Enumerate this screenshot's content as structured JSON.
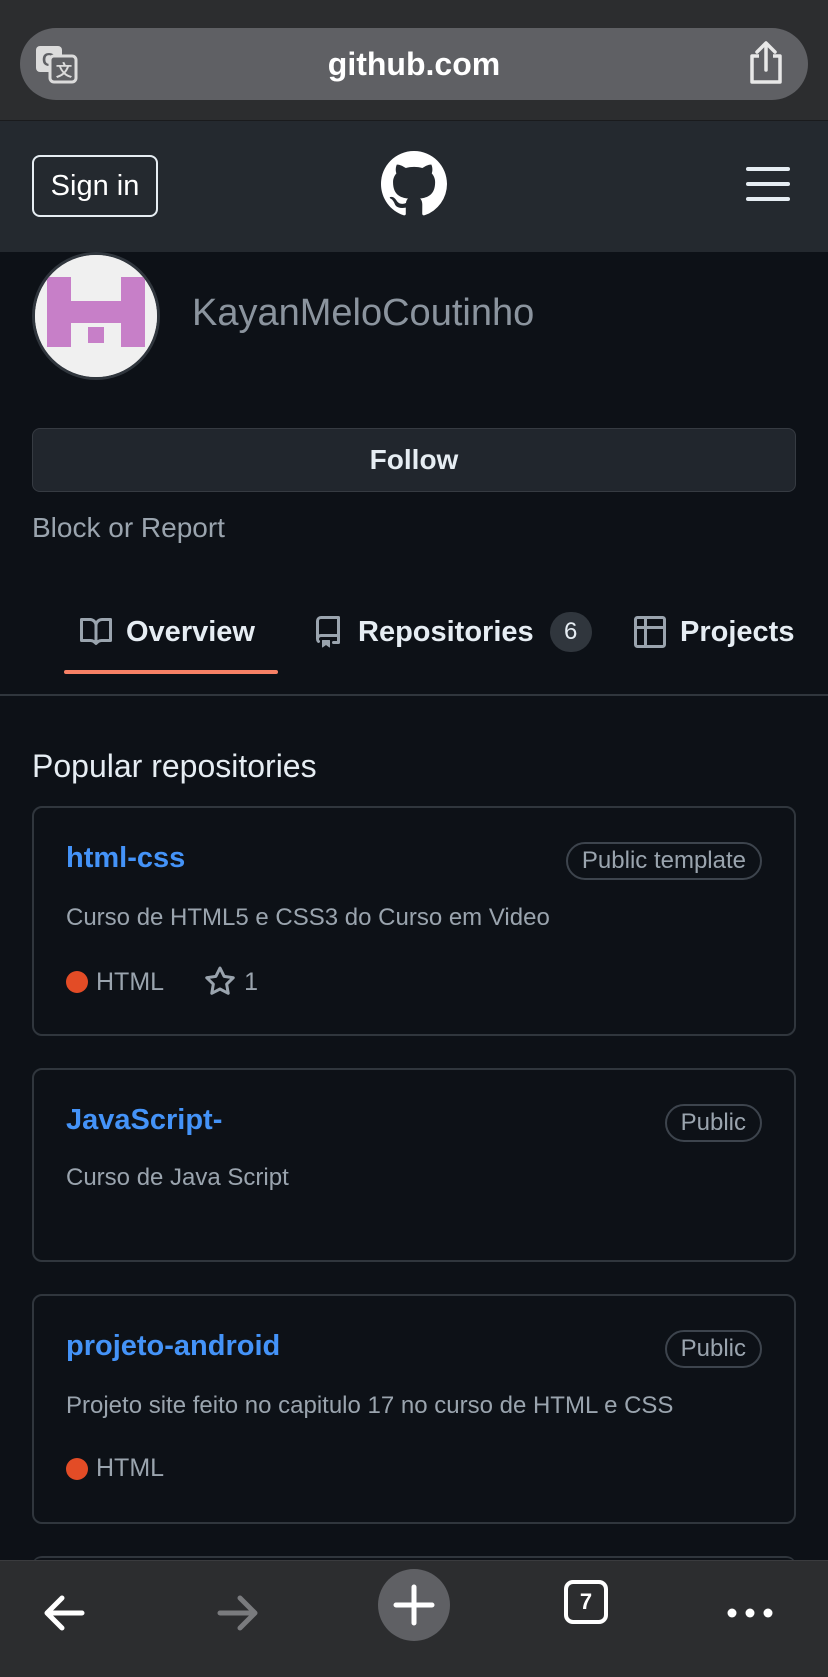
{
  "browser": {
    "url": "github.com",
    "tab_count": "7",
    "icons": [
      "translate-icon",
      "share-icon",
      "back-arrow-icon",
      "forward-arrow-icon",
      "plus-icon",
      "more-dots-icon"
    ]
  },
  "header": {
    "signin_label": "Sign in",
    "logo_icon": "github-mark-icon",
    "menu_icon": "hamburger-icon"
  },
  "profile": {
    "username": "KayanMeloCoutinho",
    "avatar_color": "#c77fc8",
    "follow_label": "Follow",
    "block_label": "Block or Report"
  },
  "tabs": [
    {
      "label": "Overview",
      "icon": "book-icon",
      "selected": true
    },
    {
      "label": "Repositories",
      "icon": "repo-icon",
      "count": "6"
    },
    {
      "label": "Projects",
      "icon": "table-icon"
    }
  ],
  "popular": {
    "title": "Popular repositories",
    "repos": [
      {
        "name": "html-css",
        "visibility": "Public template",
        "description": "Curso de HTML5 e CSS3 do Curso em Video",
        "language": "HTML",
        "language_color": "#e34c26",
        "stars": "1"
      },
      {
        "name": "JavaScript-",
        "visibility": "Public",
        "description": "Curso de Java Script"
      },
      {
        "name": "projeto-android",
        "visibility": "Public",
        "description": "Projeto site feito no capitulo 17 no curso de HTML e CSS",
        "language": "HTML",
        "language_color": "#e34c26"
      }
    ]
  },
  "colors": {
    "link": "#4493f8",
    "tab_underline": "#f78166",
    "background": "#0d1117"
  }
}
